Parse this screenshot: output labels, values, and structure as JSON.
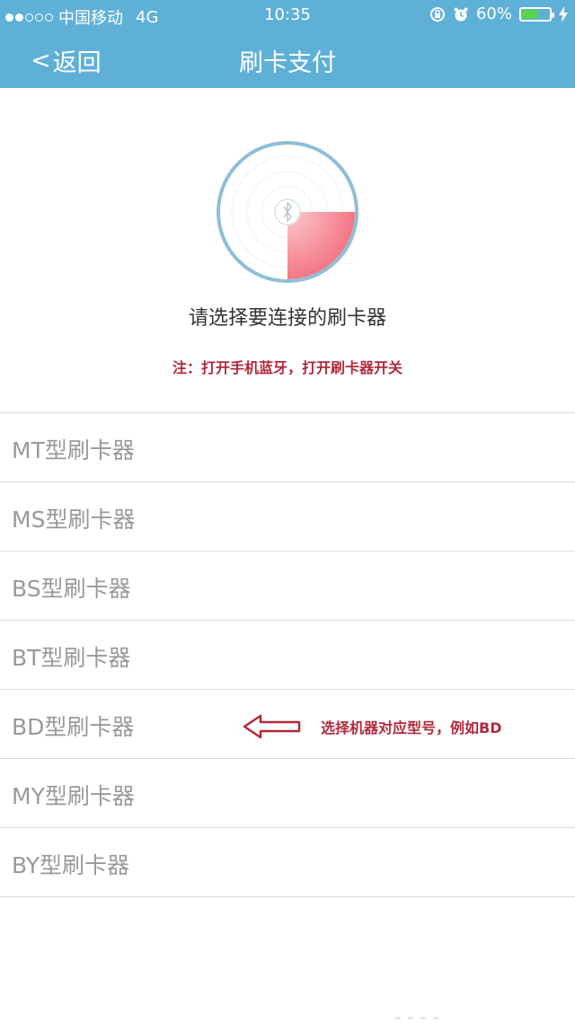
{
  "status_bar": {
    "carrier": "中国移动",
    "network": "4G",
    "time": "10:35",
    "battery_percent": "60%",
    "battery_level": 0.6,
    "signal_bars": 2,
    "icons": [
      "lock-rotation-icon",
      "alarm-icon",
      "battery-icon",
      "charging-icon"
    ]
  },
  "nav": {
    "back_label": "返回",
    "title": "刷卡支付"
  },
  "radar": {
    "icon": "bluetooth-icon",
    "ring_color": "#8fbfd6",
    "sweep_color": "#f47a85"
  },
  "prompt": "请选择要连接的刷卡器",
  "note": "注：打开手机蓝牙，打开刷卡器开关",
  "devices": [
    {
      "label": "MT型刷卡器"
    },
    {
      "label": "MS型刷卡器"
    },
    {
      "label": "BS型刷卡器"
    },
    {
      "label": "BT型刷卡器"
    },
    {
      "label": "BD型刷卡器"
    },
    {
      "label": "MY型刷卡器"
    },
    {
      "label": "BY型刷卡器"
    }
  ],
  "annotation": {
    "text": "选择机器对应型号，例如BD",
    "icon": "left-arrow-icon",
    "color": "#b02a3c"
  }
}
